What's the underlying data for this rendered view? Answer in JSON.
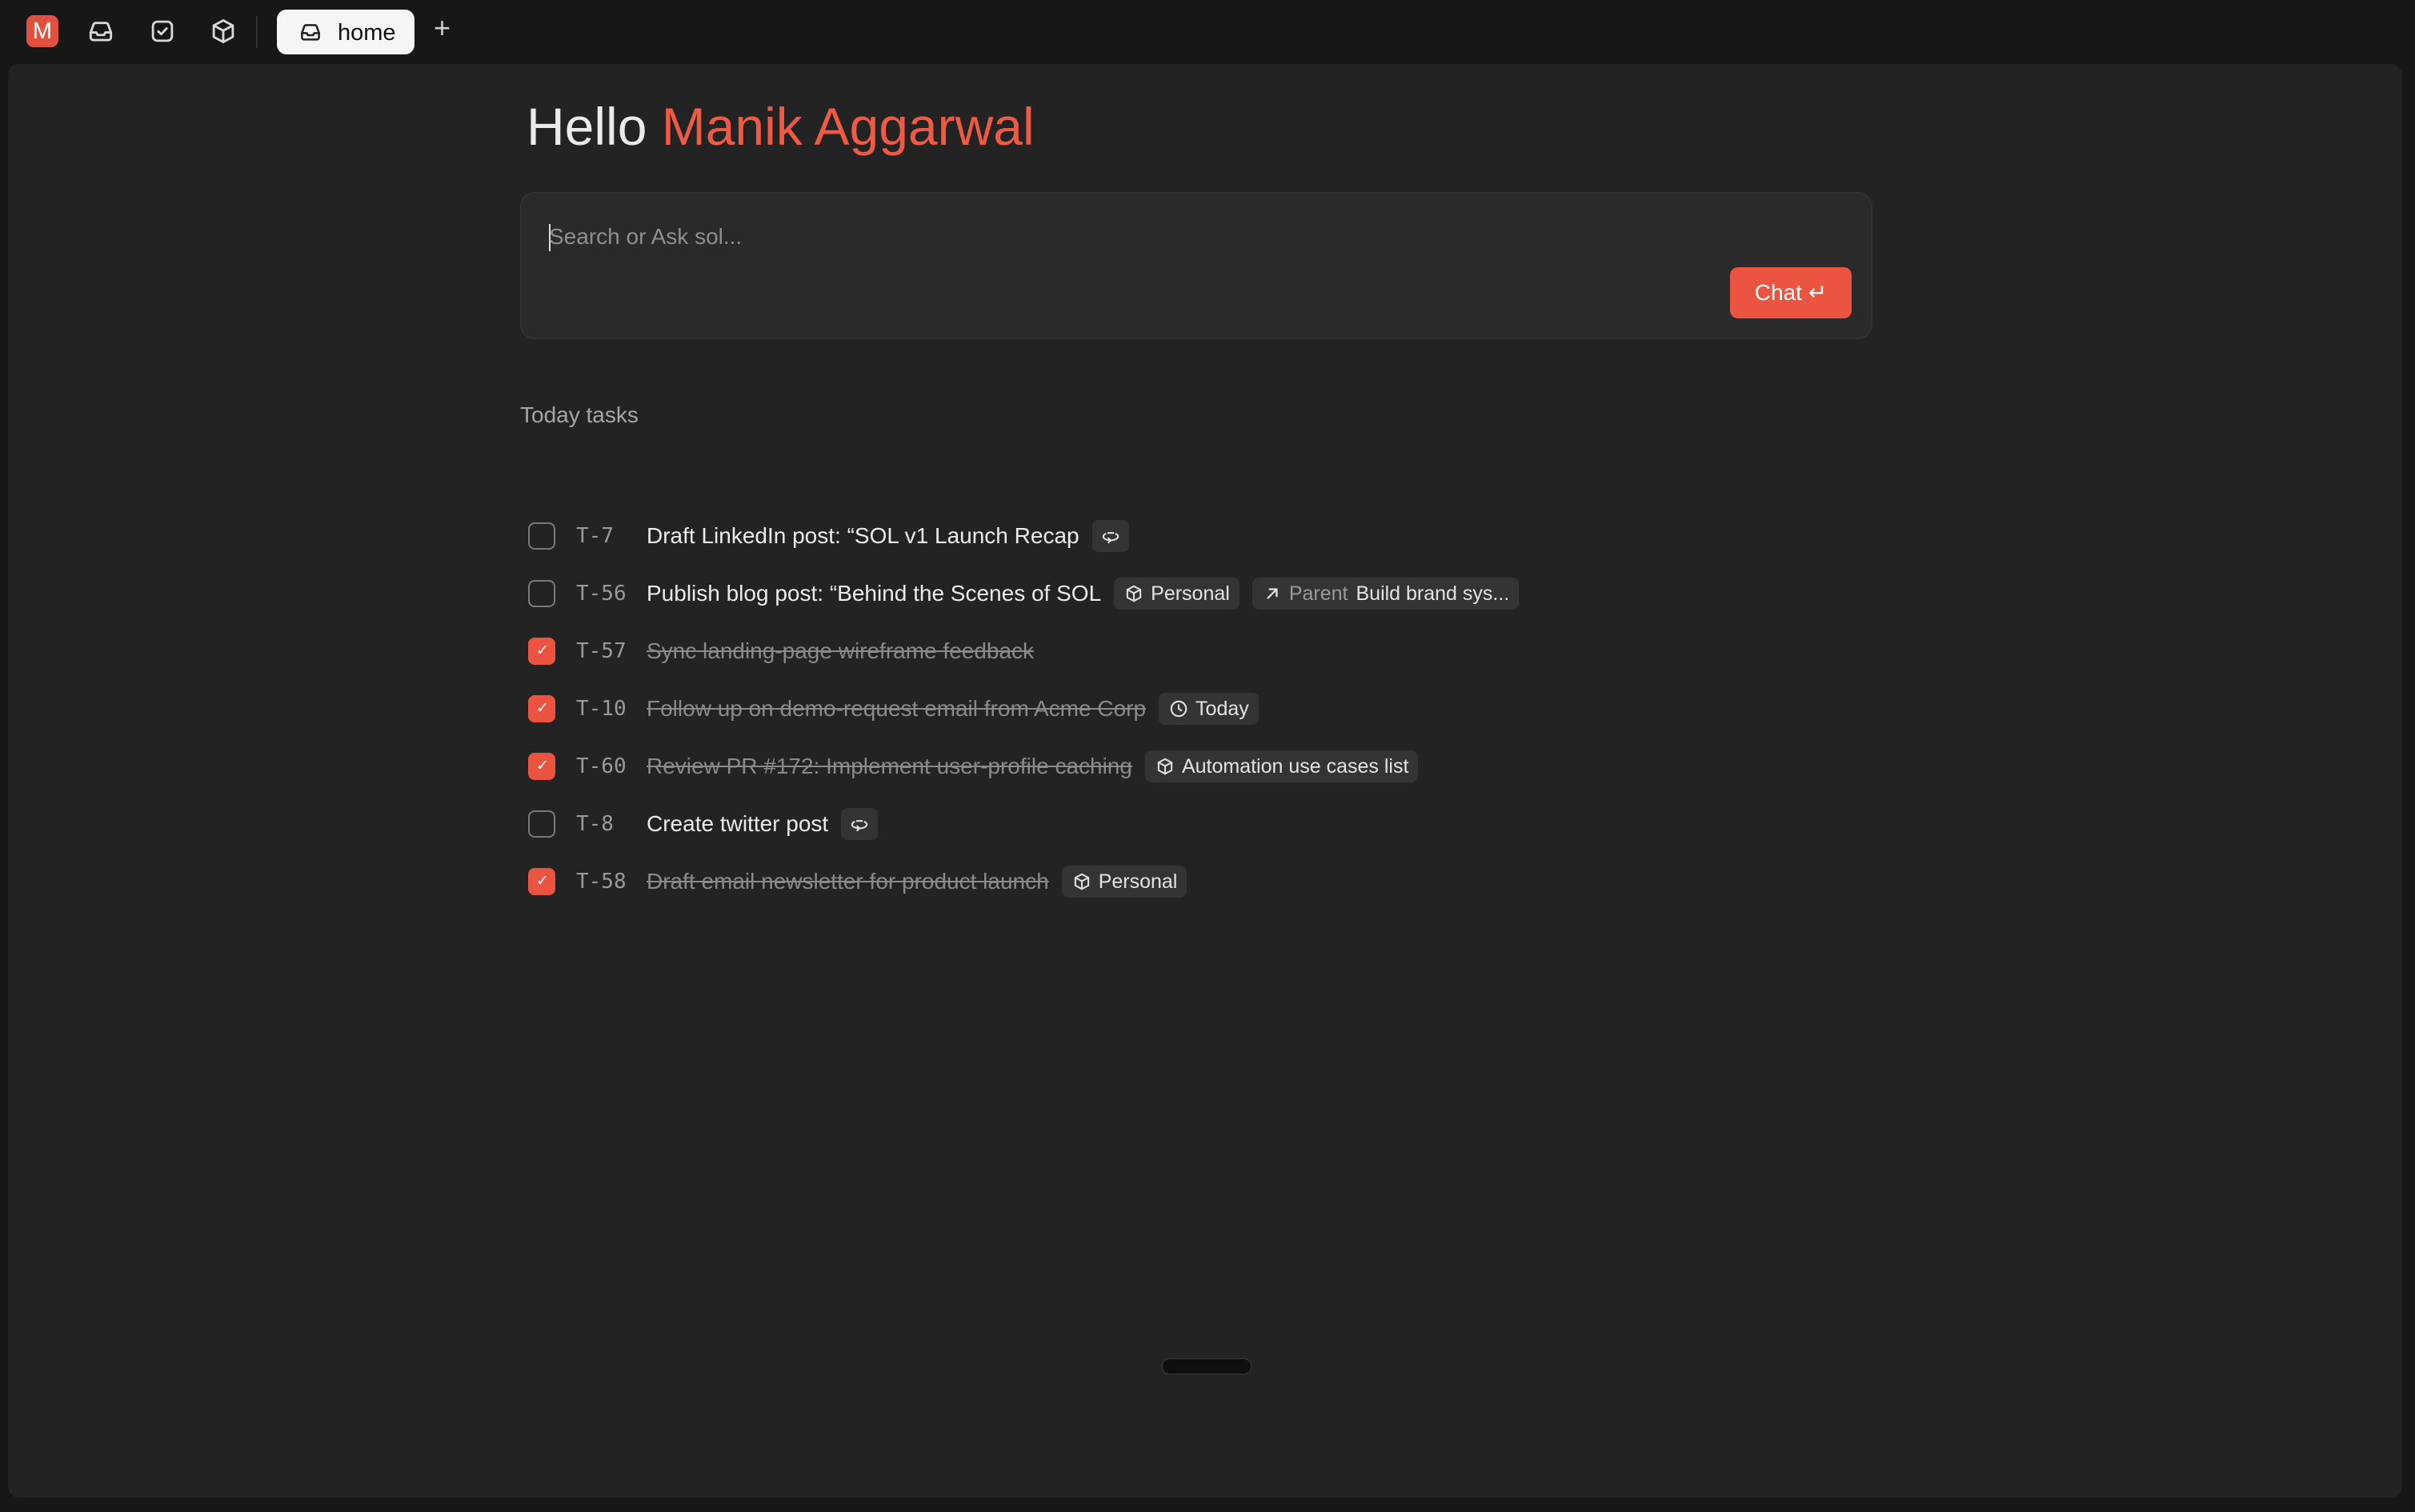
{
  "topbar": {
    "avatar_letter": "M",
    "icons": [
      "inbox-icon",
      "check-square-icon",
      "box-icon"
    ],
    "active_tab": {
      "label": "home",
      "icon": "inbox-icon"
    },
    "new_tab_label": "+"
  },
  "main": {
    "greeting": {
      "hello": "Hello",
      "name": "Manik Aggarwal"
    },
    "search": {
      "placeholder": "Search or Ask sol...",
      "chat_button": "Chat ↵"
    },
    "section_title": "Today tasks",
    "tasks": [
      {
        "id": "T-7",
        "title": "Draft LinkedIn post: “SOL v1 Launch Recap",
        "done": false,
        "chips": [
          {
            "icon": "recurring-icon"
          }
        ]
      },
      {
        "id": "T-56",
        "title": "Publish blog post: “Behind the Scenes of SOL",
        "done": false,
        "chips": [
          {
            "icon": "box-icon",
            "label": "Personal"
          },
          {
            "icon": "arrow-up-right-icon",
            "prefix": "Parent",
            "label": "Build brand sys..."
          }
        ]
      },
      {
        "id": "T-57",
        "title": "Sync landing-page wireframe feedback",
        "done": true,
        "chips": []
      },
      {
        "id": "T-10",
        "title": "Follow up on demo-request email from Acme Corp",
        "done": true,
        "chips": [
          {
            "icon": "clock-icon",
            "label": "Today"
          }
        ]
      },
      {
        "id": "T-60",
        "title": "Review PR #172: Implement user-profile caching",
        "done": true,
        "chips": [
          {
            "icon": "box-icon",
            "label": "Automation use cases list"
          }
        ]
      },
      {
        "id": "T-8",
        "title": "Create twitter post",
        "done": false,
        "chips": [
          {
            "icon": "recurring-icon"
          }
        ]
      },
      {
        "id": "T-58",
        "title": "Draft email newsletter for product launch",
        "done": true,
        "chips": [
          {
            "icon": "box-icon",
            "label": "Personal"
          }
        ]
      }
    ]
  },
  "colors": {
    "accent": "#ea5440",
    "background": "#171717",
    "panel": "#232323",
    "chip": "#343434"
  }
}
